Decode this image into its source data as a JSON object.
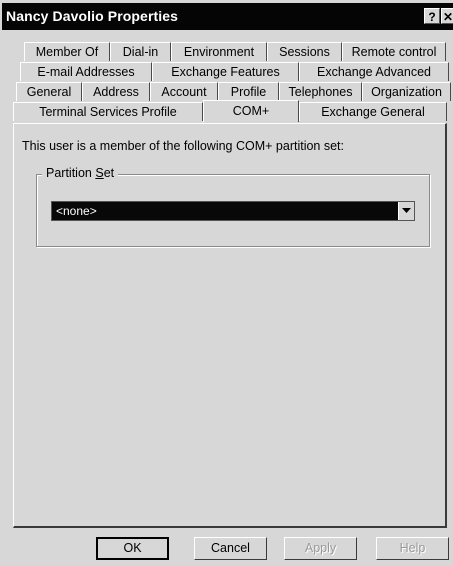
{
  "window": {
    "title": "Nancy Davolio Properties",
    "help_label": "?",
    "close_label": "✕"
  },
  "tabs": {
    "row1": [
      "Member Of",
      "Dial-in",
      "Environment",
      "Sessions",
      "Remote control"
    ],
    "row2": [
      "E-mail Addresses",
      "Exchange Features",
      "Exchange Advanced"
    ],
    "row3": [
      "General",
      "Address",
      "Account",
      "Profile",
      "Telephones",
      "Organization"
    ],
    "row4": [
      "Terminal Services Profile",
      "COM+",
      "Exchange General"
    ],
    "active": "COM+"
  },
  "content": {
    "intro": "This user is a member of the following COM+ partition set:",
    "group_label_prefix": "Partition ",
    "group_label_underlined": "S",
    "group_label_suffix": "et",
    "partition_value": "<none>"
  },
  "buttons": {
    "ok": "OK",
    "cancel": "Cancel",
    "apply": "Apply",
    "help": "Help"
  }
}
